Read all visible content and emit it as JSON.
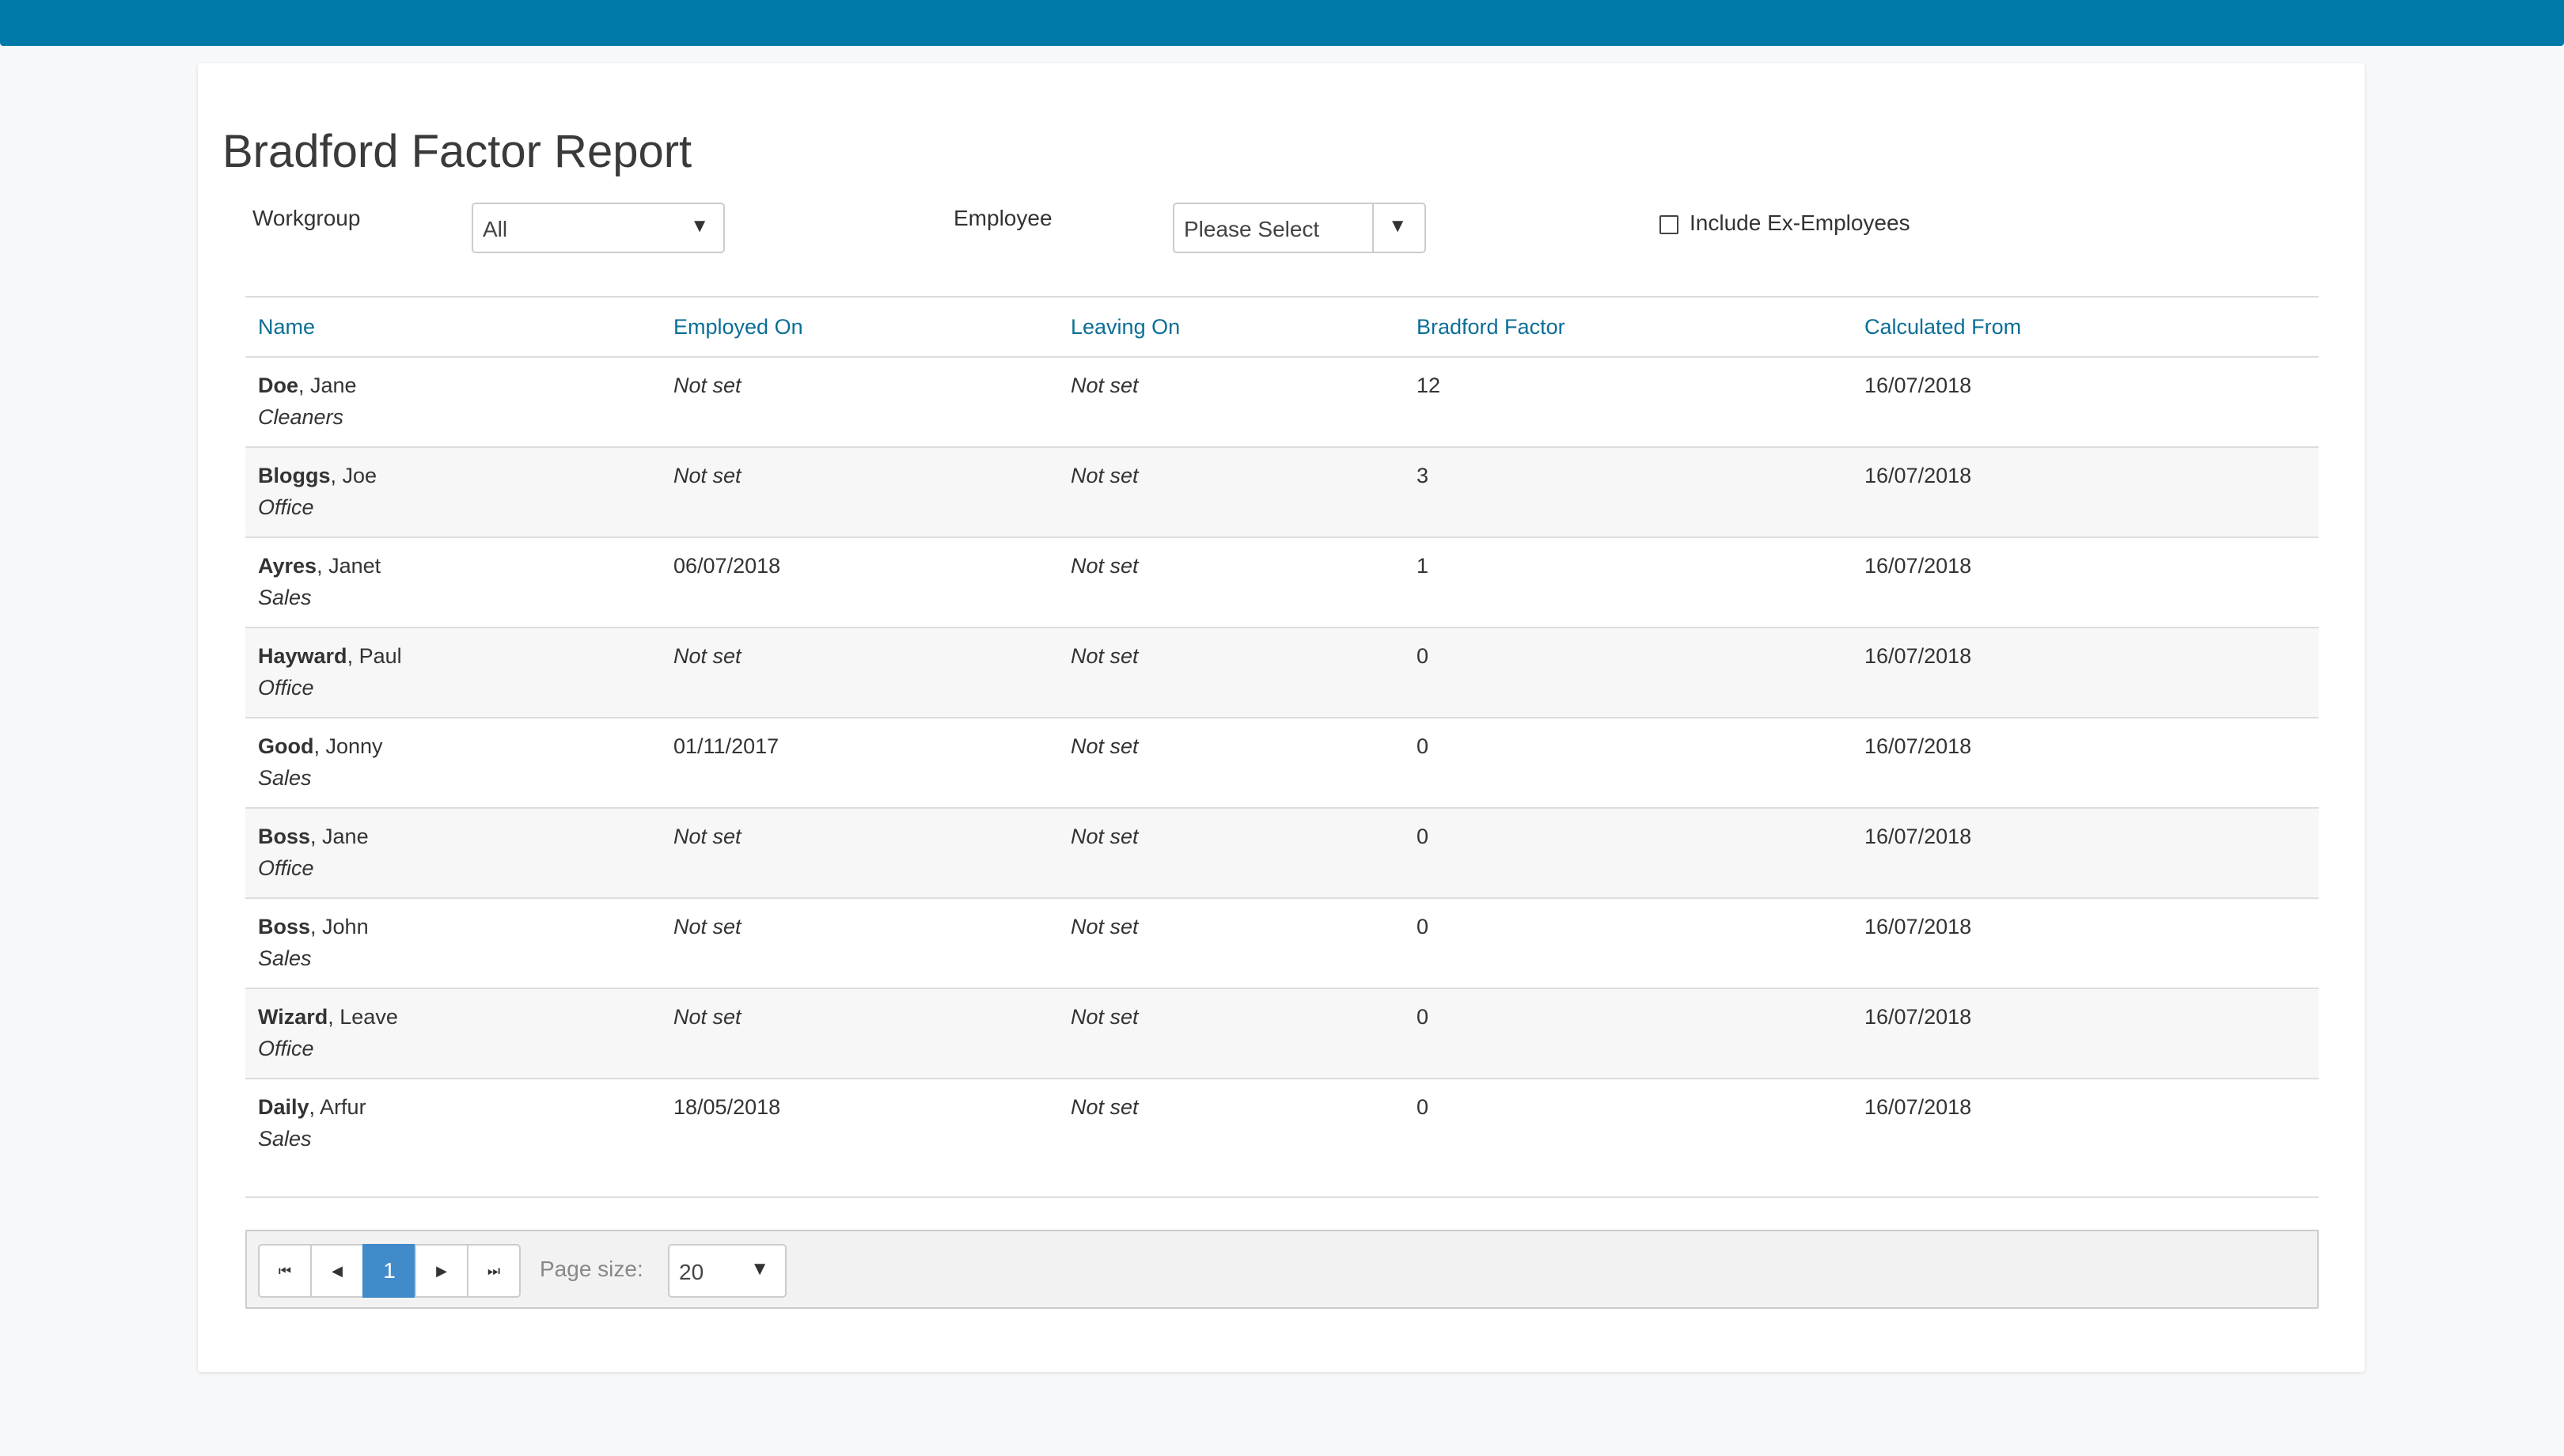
{
  "page": {
    "title": "Bradford Factor Report"
  },
  "filters": {
    "workgroup_label": "Workgroup",
    "workgroup_value": "All",
    "employee_label": "Employee",
    "employee_value": "Please Select",
    "include_ex_label": "Include Ex-Employees",
    "include_ex_checked": false
  },
  "table": {
    "headers": [
      "Name",
      "Employed On",
      "Leaving On",
      "Bradford Factor",
      "Calculated From"
    ],
    "rows": [
      {
        "last": "Doe",
        "first": ", Jane",
        "group": "Cleaners",
        "employed_on": "Not set",
        "leaving_on": "Not set",
        "bradford": "12",
        "calculated_from": "16/07/2018"
      },
      {
        "last": "Bloggs",
        "first": ", Joe",
        "group": "Office",
        "employed_on": "Not set",
        "leaving_on": "Not set",
        "bradford": "3",
        "calculated_from": "16/07/2018"
      },
      {
        "last": "Ayres",
        "first": ", Janet",
        "group": "Sales",
        "employed_on": "06/07/2018",
        "leaving_on": "Not set",
        "bradford": "1",
        "calculated_from": "16/07/2018"
      },
      {
        "last": "Hayward",
        "first": ", Paul",
        "group": "Office",
        "employed_on": "Not set",
        "leaving_on": "Not set",
        "bradford": "0",
        "calculated_from": "16/07/2018"
      },
      {
        "last": "Good",
        "first": ", Jonny",
        "group": "Sales",
        "employed_on": "01/11/2017",
        "leaving_on": "Not set",
        "bradford": "0",
        "calculated_from": "16/07/2018"
      },
      {
        "last": "Boss",
        "first": ", Jane",
        "group": "Office",
        "employed_on": "Not set",
        "leaving_on": "Not set",
        "bradford": "0",
        "calculated_from": "16/07/2018"
      },
      {
        "last": "Boss",
        "first": ", John",
        "group": "Sales",
        "employed_on": "Not set",
        "leaving_on": "Not set",
        "bradford": "0",
        "calculated_from": "16/07/2018"
      },
      {
        "last": "Wizard",
        "first": ", Leave",
        "group": "Office",
        "employed_on": "Not set",
        "leaving_on": "Not set",
        "bradford": "0",
        "calculated_from": "16/07/2018"
      },
      {
        "last": "Daily",
        "first": ", Arfur",
        "group": "Sales",
        "employed_on": "18/05/2018",
        "leaving_on": "Not set",
        "bradford": "0",
        "calculated_from": "16/07/2018"
      }
    ]
  },
  "pager": {
    "first_icon": "first-page-icon",
    "prev_icon": "prev-page-icon",
    "current_page": "1",
    "next_icon": "next-page-icon",
    "last_icon": "last-page-icon",
    "page_size_label": "Page size:",
    "page_size_value": "20"
  },
  "colors": {
    "topbar": "#0078a8",
    "header_text": "#0a6e96",
    "active_page": "#428bca"
  }
}
